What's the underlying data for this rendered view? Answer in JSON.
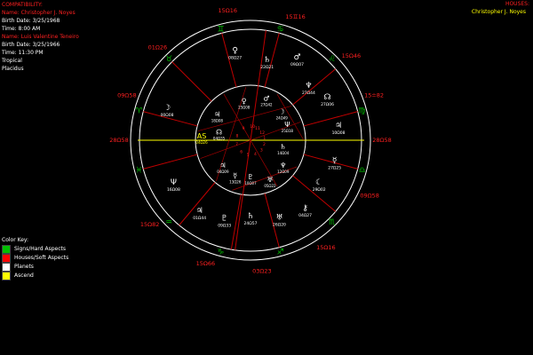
{
  "header": {
    "title": "COMPATIBILITY:",
    "person1": {
      "name": "Name: Christopher J. Noyes",
      "birth_date": "Birth Date: 3/25/1968",
      "time": "Time: 8:00 AM"
    },
    "person2": {
      "name": "Name: Luis Valentine Teneiro",
      "birth_date": "Birth Date: 3/25/1966",
      "time": "Time: 11:30 PM"
    },
    "zodiac": "Tropical",
    "house_system": "Placidus"
  },
  "houses_panel": {
    "title": "HOUSES:",
    "name": "Christopher J. Noyes"
  },
  "color_key": {
    "title": "Color Key:",
    "items": [
      {
        "label": "Signs/Hard Aspects",
        "color": "#00c000"
      },
      {
        "label": "Houses/Soft Aspects",
        "color": "#ff0000"
      },
      {
        "label": "Planets",
        "color": "#ffffff"
      },
      {
        "label": "Ascend",
        "color": "#ffff00"
      }
    ]
  },
  "wheel": {
    "cusps": [
      {
        "label": "15Ω16"
      },
      {
        "label": "15♊16"
      },
      {
        "label": "15Ω46"
      },
      {
        "label": "15≏82"
      },
      {
        "label": "28Ω58"
      },
      {
        "label": "09Ω58"
      },
      {
        "label": "15Ω16"
      },
      {
        "label": "03Ω23"
      },
      {
        "label": "15Ω66"
      },
      {
        "label": "15Ω82"
      },
      {
        "label": "28Ω58"
      },
      {
        "label": "09Ω58"
      },
      {
        "label": "01Ω26"
      }
    ],
    "outer_planets": [
      {
        "glyph": "♀",
        "label": "08Ω27"
      },
      {
        "glyph": "♄",
        "label": "22Ω21"
      },
      {
        "glyph": "♂",
        "label": "09Ω07"
      },
      {
        "glyph": "♆",
        "label": "27Ω44"
      },
      {
        "glyph": "☊",
        "label": "27Ω06"
      },
      {
        "glyph": "♃",
        "label": "10Ω08"
      },
      {
        "glyph": "☿",
        "label": "27Ω25"
      },
      {
        "glyph": "☾",
        "label": "29Ω02"
      },
      {
        "glyph": "⚷",
        "label": "04Ω27"
      },
      {
        "glyph": "♅",
        "label": "26Ω20"
      },
      {
        "glyph": "♄",
        "label": "24Ω57"
      },
      {
        "glyph": "♇",
        "label": "09Ω33"
      },
      {
        "glyph": "♃",
        "label": "01Ω44"
      },
      {
        "glyph": "Ψ",
        "label": "16Ω08"
      },
      {
        "glyph": "☽",
        "label": "00Ω08"
      }
    ],
    "inner_planets": [
      {
        "glyph": "♂",
        "label": "27Ω42"
      },
      {
        "glyph": "♀",
        "label": "25Ω08"
      },
      {
        "glyph": "♃",
        "label": "18Ω08"
      },
      {
        "glyph": "AS",
        "label": "04Ω26"
      },
      {
        "glyph": "☊",
        "label": "04Ω35"
      },
      {
        "glyph": "♄",
        "label": "14Ω04"
      },
      {
        "glyph": "♆",
        "label": "12Ω09"
      },
      {
        "glyph": "♅",
        "label": "05Ω22"
      },
      {
        "glyph": "♇",
        "label": "10Ω07"
      },
      {
        "glyph": "☿",
        "label": "13Ω26"
      },
      {
        "glyph": "♃",
        "label": "04Ω09"
      },
      {
        "glyph": "Ψ",
        "label": "25Ω18"
      },
      {
        "glyph": "☽",
        "label": "24Ω49"
      }
    ],
    "inner_ring_numbers": [
      "10",
      "11",
      "12",
      "1",
      "2",
      "3",
      "4",
      "5",
      "6",
      "7",
      "8",
      "9"
    ]
  }
}
